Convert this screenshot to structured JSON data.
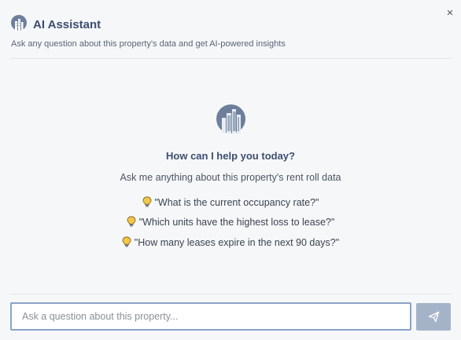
{
  "header": {
    "title": "AI Assistant",
    "subtitle": "Ask any question about this property's data and get AI-powered insights",
    "close_label": "×"
  },
  "welcome": {
    "heading": "How can I help you today?",
    "intro": "Ask me anything about this property's rent roll data"
  },
  "suggestions": [
    "\"What is the current occupancy rate?\"",
    "\"Which units have the highest loss to lease?\"",
    "\"How many leases expire in the next 90 days?\""
  ],
  "composer": {
    "placeholder": "Ask a question about this property...",
    "value": ""
  },
  "icons": {
    "logo": "building-logo-icon",
    "close": "close-icon",
    "suggestion": "lightbulb-icon",
    "send": "send-icon"
  },
  "colors": {
    "accent": "#3d4f6e",
    "logo_circle": "#6d7f9b",
    "bulb": "#f2c84b",
    "send_button": "#a5b3c8",
    "input_border": "#8aa3c6"
  }
}
